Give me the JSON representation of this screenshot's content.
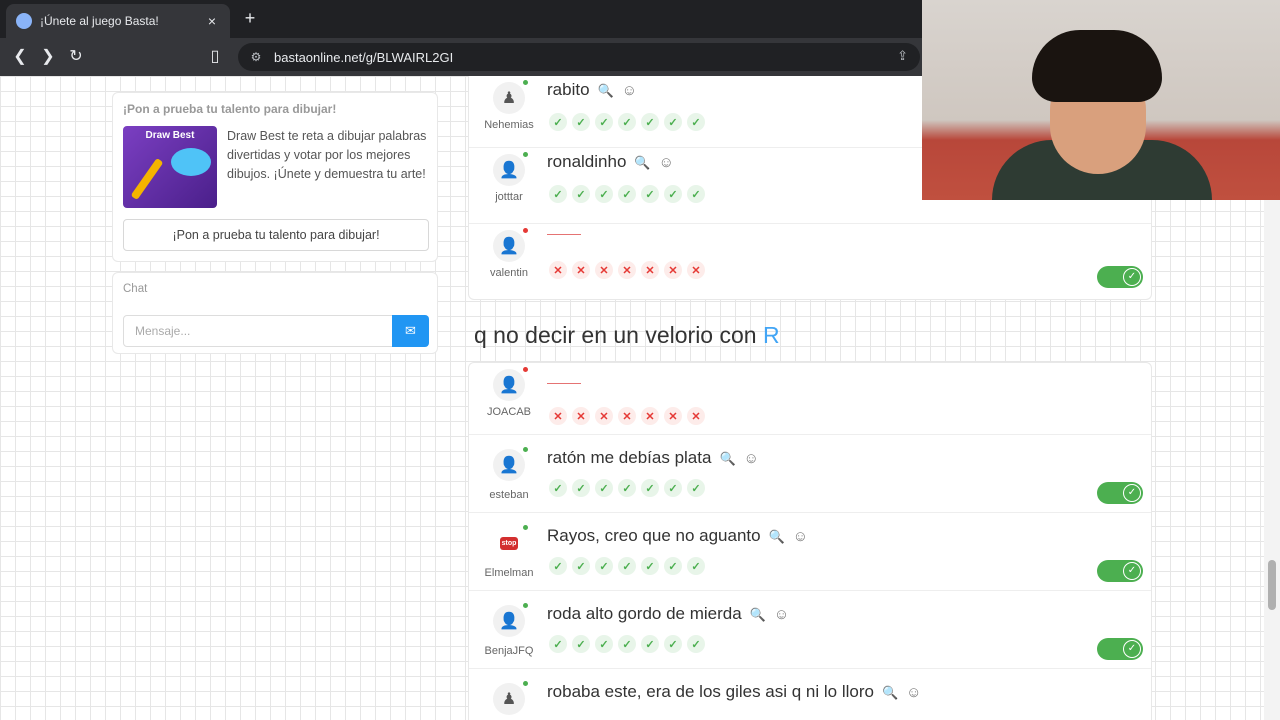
{
  "browser": {
    "tab_title": "¡Únete al juego Basta!",
    "tab_close": "×",
    "new_tab": "+",
    "url": "bastaonline.net/g/BLWAIRL2GI",
    "icons": [
      "back-icon",
      "forward-icon",
      "reload-icon",
      "bookmark-icon",
      "site-settings-icon",
      "share-icon"
    ]
  },
  "sidebar": {
    "promo": {
      "title": "¡Pon a prueba tu talento para dibujar!",
      "image_title": "Draw Best",
      "text": "Draw Best te reta a dibujar palabras divertidas y votar por los mejores dibujos. ¡Únete y demuestra tu arte!",
      "button": "¡Pon a prueba tu talento para dibujar!"
    },
    "chat": {
      "title": "Chat",
      "placeholder": "Mensaje..."
    }
  },
  "round_top": {
    "rows": [
      {
        "user": "Nehemias",
        "answer": "rabito",
        "status": "online",
        "votes": [
          "ok",
          "ok",
          "ok",
          "ok",
          "ok",
          "ok",
          "ok"
        ],
        "avatar": "user-star-icon"
      },
      {
        "user": "jotttar",
        "answer": "ronaldinho",
        "status": "online",
        "votes": [
          "ok",
          "ok",
          "ok",
          "ok",
          "ok",
          "ok",
          "ok"
        ],
        "avatar": "user-icon",
        "toggle": true
      },
      {
        "user": "valentin",
        "answer": "",
        "status": "offline",
        "votes": [
          "bad",
          "bad",
          "bad",
          "bad",
          "bad",
          "bad",
          "bad"
        ],
        "avatar": "user-icon"
      }
    ]
  },
  "category": {
    "text": "q no decir en un velorio con ",
    "letter": "R"
  },
  "round_bottom": {
    "rows": [
      {
        "user": "JOACAB",
        "answer": "",
        "status": "offline",
        "votes": [
          "bad",
          "bad",
          "bad",
          "bad",
          "bad",
          "bad",
          "bad"
        ],
        "avatar": "user-icon"
      },
      {
        "user": "esteban",
        "answer": "ratón me debías plata",
        "status": "online",
        "votes": [
          "ok",
          "ok",
          "ok",
          "ok",
          "ok",
          "ok",
          "ok"
        ],
        "avatar": "user-icon",
        "toggle": true
      },
      {
        "user": "Elmelman",
        "answer": "Rayos, creo que no aguanto",
        "status": "online",
        "votes": [
          "ok",
          "ok",
          "ok",
          "ok",
          "ok",
          "ok",
          "ok"
        ],
        "avatar": "stop-icon",
        "toggle": true
      },
      {
        "user": "BenjaJFQ",
        "answer": "roda alto gordo de mierda",
        "status": "online",
        "votes": [
          "ok",
          "ok",
          "ok",
          "ok",
          "ok",
          "ok",
          "ok"
        ],
        "avatar": "user-icon",
        "toggle": true
      },
      {
        "user": "",
        "answer": "robaba este, era de los giles asi q ni lo lloro",
        "status": "online",
        "votes": [],
        "avatar": "user-star-icon"
      }
    ]
  },
  "stop_badge": "stop",
  "colors": {
    "accent": "#42a5f5",
    "ok": "#4caf50",
    "bad": "#e53935",
    "send": "#2196f3"
  }
}
